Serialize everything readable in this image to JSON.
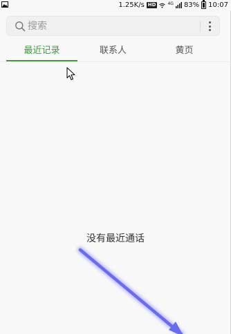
{
  "status_bar": {
    "speed": "1.25K/s",
    "hd": "HD",
    "network": "4G",
    "battery": "83%",
    "time": "10:07"
  },
  "search": {
    "placeholder": "搜索",
    "value": ""
  },
  "tabs": [
    {
      "label": "最近记录",
      "active": true
    },
    {
      "label": "联系人",
      "active": false
    },
    {
      "label": "黄页",
      "active": false
    }
  ],
  "empty_state": {
    "message": "没有最近通话"
  },
  "colors": {
    "accent": "#3c9b3c",
    "annotation_arrow": "#6a6cf0"
  },
  "icons": {
    "search": "search-icon",
    "more": "more-vertical-icon",
    "wifi": "wifi-icon",
    "signal": "signal-icon",
    "battery": "battery-icon",
    "gallery": "image-icon"
  }
}
